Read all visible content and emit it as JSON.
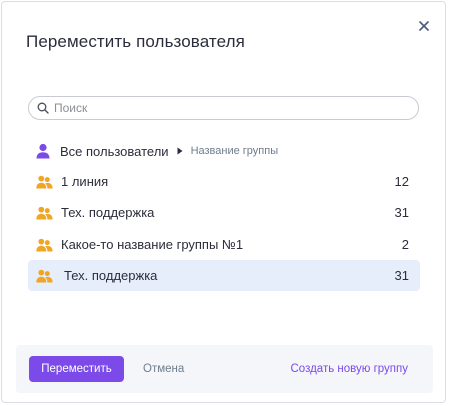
{
  "dialog": {
    "title": "Переместить пользователя",
    "close_icon": "close-icon"
  },
  "search": {
    "placeholder": "Поиск",
    "value": "",
    "icon": "search-icon"
  },
  "breadcrumb": {
    "root_label": "Все пользователи",
    "root_icon": "user-icon",
    "separator_icon": "caret-right-icon",
    "current_label": "Название группы"
  },
  "groups": [
    {
      "name": "1 линия",
      "count": "12",
      "selected": false,
      "icon": "users-group-icon"
    },
    {
      "name": "Тех. поддержка",
      "count": "31",
      "selected": false,
      "icon": "users-group-icon"
    },
    {
      "name": "Какое-то название группы №1",
      "count": "2",
      "selected": false,
      "icon": "users-group-icon"
    },
    {
      "name": "Тех. поддержка",
      "count": "31",
      "selected": true,
      "icon": "users-group-icon"
    }
  ],
  "footer": {
    "move_label": "Переместить",
    "cancel_label": "Отмена",
    "create_group_label": "Создать новую группу"
  },
  "colors": {
    "accent": "#7b4ae8",
    "group_icon": "#f0a624",
    "selected_row": "#e6eefb",
    "text": "#2b2d3b",
    "muted": "#6f7d8c"
  }
}
